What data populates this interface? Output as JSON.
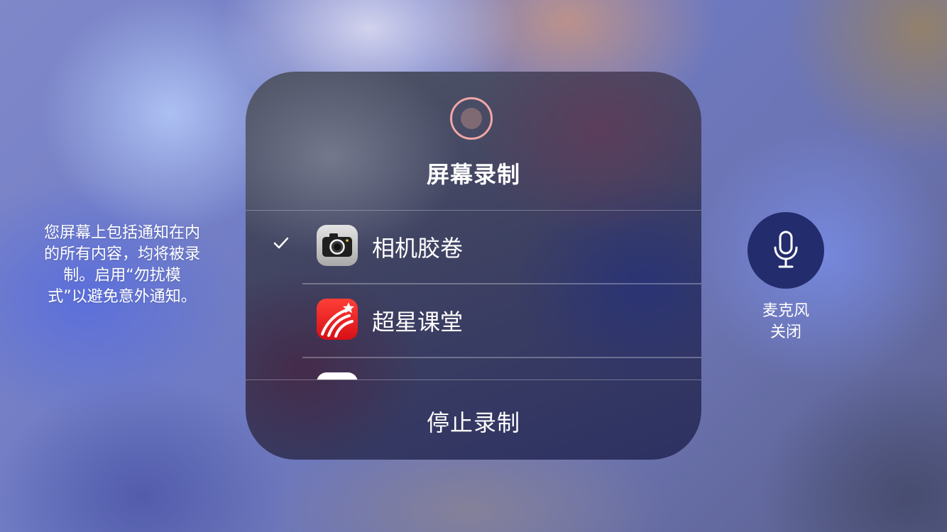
{
  "notice": {
    "text": "您屏幕上包括通知在内\n的所有内容，均将被录\n制。启用“勿扰模\n式”以避免意外通知。"
  },
  "panel": {
    "title": "屏幕录制",
    "destinations": [
      {
        "label": "相机胶卷",
        "icon": "camera-icon",
        "selected": true
      },
      {
        "label": "超星课堂",
        "icon": "chaoxing-app-icon",
        "selected": false
      },
      {
        "label": "",
        "icon": "partial-app-icon",
        "selected": false
      }
    ],
    "stop_label": "停止录制"
  },
  "microphone": {
    "label": "麦克风",
    "status": "关闭",
    "icon": "microphone-icon"
  },
  "colors": {
    "record_ring": "#f0a7a7",
    "mic_button": "#232c6c"
  }
}
